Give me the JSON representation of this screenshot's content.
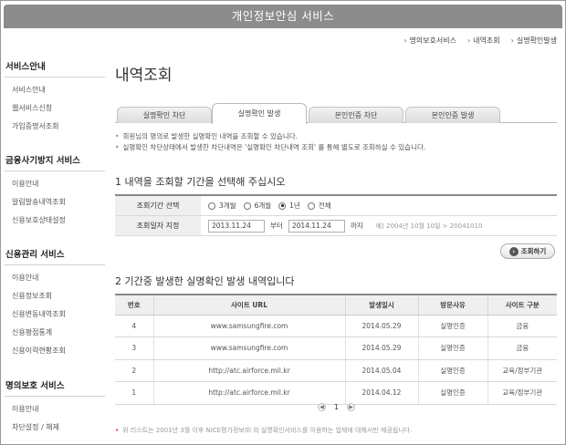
{
  "window": {
    "title": "개인정보안심 서비스"
  },
  "topnav": [
    "명의보호서비스",
    "내역조회",
    "실명확인발생"
  ],
  "sidebar": {
    "sections": [
      {
        "title": "서비스안내",
        "items": [
          "서비스안내",
          "웹서비스신청",
          "가입증명서조회"
        ]
      },
      {
        "title": "금융사기방지 서비스",
        "items": [
          "이용안내",
          "알림발송내역조회",
          "신용보호상태설정"
        ]
      },
      {
        "title": "신용관리 서비스",
        "items": [
          "이용안내",
          "신용정보조회",
          "신용변동내역조회",
          "신용평점통계",
          "신용이력현황조회"
        ]
      },
      {
        "title": "명의보호 서비스",
        "items": [
          "이용안내",
          "차단설정 / 해제"
        ]
      }
    ]
  },
  "main": {
    "title": "내역조회",
    "tabs": [
      "실명확인 차단",
      "실명확인 발생",
      "본인인증 차단",
      "본인인증 발생"
    ],
    "active_tab": 1,
    "notes": [
      "회원님의 명의로 발생한 실명확인 내역을 조회할 수 있습니다.",
      "실명확인 차단상태에서 발생한 차단내역은 '실명확인 차단내역 조회' 를 통해 별도로 조회하실 수 있습니다."
    ],
    "section1_title": "1 내역을 조회할 기간을 선택해 주십시오",
    "period_label": "조회기간 선택",
    "period_options": [
      "3개월",
      "6개월",
      "1년",
      "전체"
    ],
    "period_selected": 2,
    "date_label": "조회일자 지정",
    "date_from": "2013.11.24",
    "date_from_suffix": "부터",
    "date_to": "2014.11.24",
    "date_to_suffix": "까지",
    "date_hint": "예) 2004년 10월 10일 > 20041010",
    "search_button": "조회하기",
    "section2_title": "2 기간중 발생한 실명확인 발생 내역입니다",
    "table": {
      "headers": [
        "번호",
        "사이트 URL",
        "발생일시",
        "방문사유",
        "사이트 구분"
      ],
      "rows": [
        [
          "4",
          "www.samsungfire.com",
          "2014.05.29",
          "실명인증",
          "금융"
        ],
        [
          "3",
          "www.samsungfire.com",
          "2014.05.29",
          "실명인증",
          "금융"
        ],
        [
          "2",
          "http://atc.airforce.mil.kr",
          "2014.05.04",
          "실명인증",
          "교육/정부기관"
        ],
        [
          "1",
          "http://atc.airforce.mil.kr",
          "2014.04.12",
          "실명인증",
          "교육/정부기관"
        ]
      ]
    },
    "pager": {
      "current": "1"
    },
    "footnote": "위 리스트는 2001년 3월 이후 NICE평가정보㈜ 의 실명확인서비스를 이용하는 업체에 대해서만 제공됩니다."
  }
}
